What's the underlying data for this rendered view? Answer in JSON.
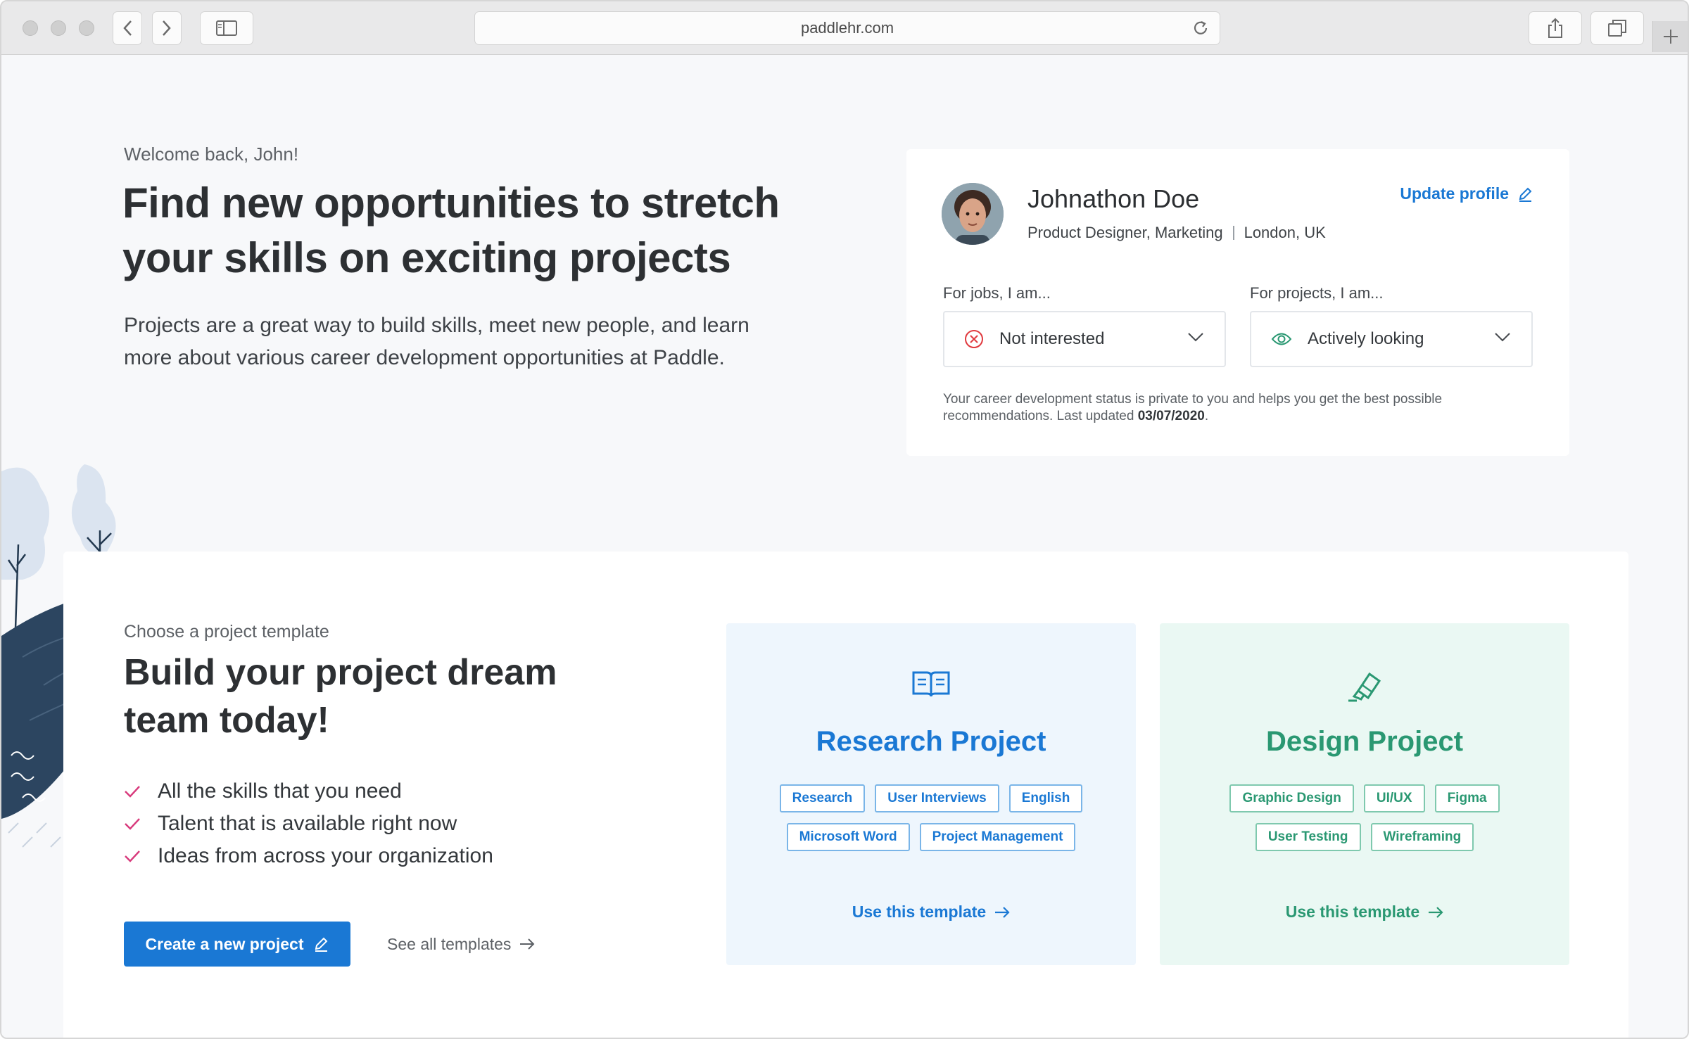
{
  "browser": {
    "url": "paddlehr.com"
  },
  "hero": {
    "welcome": "Welcome back, John!",
    "headline_line1": "Find new opportunities to stretch",
    "headline_line2": "your skills on exciting projects",
    "intro_line1": "Projects are a great way to build skills, meet new people, and learn",
    "intro_line2": "more about various career development opportunities at Paddle."
  },
  "profile": {
    "name": "Johnathon Doe",
    "role": "Product Designer, Marketing",
    "location": "London, UK",
    "update_label": "Update profile",
    "jobs_label": "For jobs, I am...",
    "jobs_status": "Not interested",
    "projects_label": "For projects, I am...",
    "projects_status": "Actively looking",
    "privacy_text": "Your career development status is private to you and helps you get the best possible recommendations. Last updated ",
    "last_updated": "03/07/2020",
    "privacy_end": ".",
    "colors": {
      "not_interested": "#e0393e",
      "actively_looking": "#2a9872"
    }
  },
  "templates_section": {
    "eyebrow": "Choose a project template",
    "title_line1": "Build your project dream",
    "title_line2": "team today!",
    "benefits": [
      "All the skills that you need",
      "Talent that is available right now",
      "Ideas from across your organization"
    ],
    "create_label": "Create a new project",
    "see_all_label": "See all templates"
  },
  "template_cards": [
    {
      "title": "Research Project",
      "icon": "book-icon",
      "tags": [
        "Research",
        "User Interviews",
        "English",
        "Microsoft Word",
        "Project Management"
      ],
      "cta": "Use this template",
      "color": "#1a78d4"
    },
    {
      "title": "Design Project",
      "icon": "highlighter-icon",
      "tags": [
        "Graphic Design",
        "UI/UX",
        "Figma",
        "User Testing",
        "Wireframing"
      ],
      "cta": "Use this template",
      "color": "#2a9872"
    }
  ],
  "theme": {
    "accent": "#1a78d4",
    "check_color": "#d83a7c"
  }
}
